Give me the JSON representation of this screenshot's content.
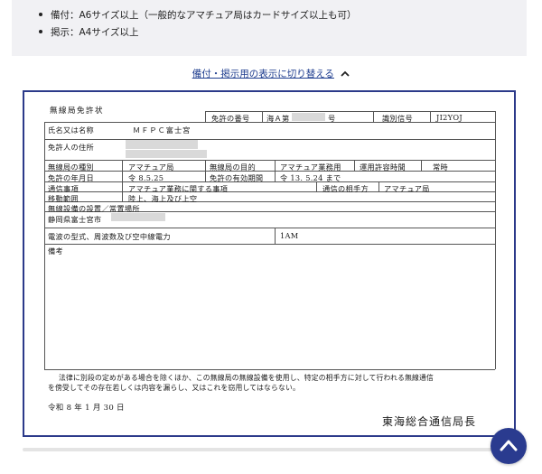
{
  "info": {
    "items": [
      "備付：A6サイズ以上（一般的なアマチュア局はカードサイズ以上も可）",
      "掲示：A4サイズ以上"
    ]
  },
  "toggle": {
    "label": "備付・掲示用の表示に切り替える",
    "icon": "chevron-up-icon"
  },
  "license": {
    "title": "無線局免許状",
    "license_no_label": "免許の番号",
    "license_no_prefix": "海Ａ第",
    "license_no_suffix": "号",
    "callsign_label": "識別信号",
    "callsign": "JI2YOJ",
    "name_label": "氏名又は名称",
    "name_value": "ＭＦＰＣ富士宮",
    "address_label": "免許人の住所",
    "station_type_label": "無線局の種別",
    "station_type": "アマチュア局",
    "purpose_label": "無線局の目的",
    "purpose": "アマチュア業務用",
    "op_time_label": "運用許容時間",
    "op_time": "常時",
    "date_label": "免許の年月日",
    "date": "令 8.5.25",
    "valid_label": "免許の有効期間",
    "valid": "令 13. 5.24 まで",
    "comm_label": "通信事項",
    "comm": "アマチュア業務に関する事項",
    "partner_label": "通信の相手方",
    "partner": "アマチュア局",
    "range_label": "移動範囲",
    "range": "陸上、海上及び上空",
    "location_label": "無線設備の設置／常置場所",
    "location": "静岡県富士宮市",
    "radio_label": "電波の型式、周波数及び空中線電力",
    "radio_value": "1AM",
    "remarks_label": "備考",
    "notice_1": "法律に別段の定めがある場合を除くほか、この無線局の無線設備を使用し、特定の相手方に対して行われる無線通信",
    "notice_2": "を傍受してその存在若しくは内容を漏らし、又はこれを窃用してはならない。",
    "issue_date": "令和 8 年 1 月 30 日",
    "issuer": "東海総合通信局長"
  },
  "scroll_top": {
    "icon": "chevron-up-icon"
  },
  "colors": {
    "accent": "#2a3b8f",
    "link": "#1e3d8f",
    "info_bg": "#f1f1f4"
  }
}
